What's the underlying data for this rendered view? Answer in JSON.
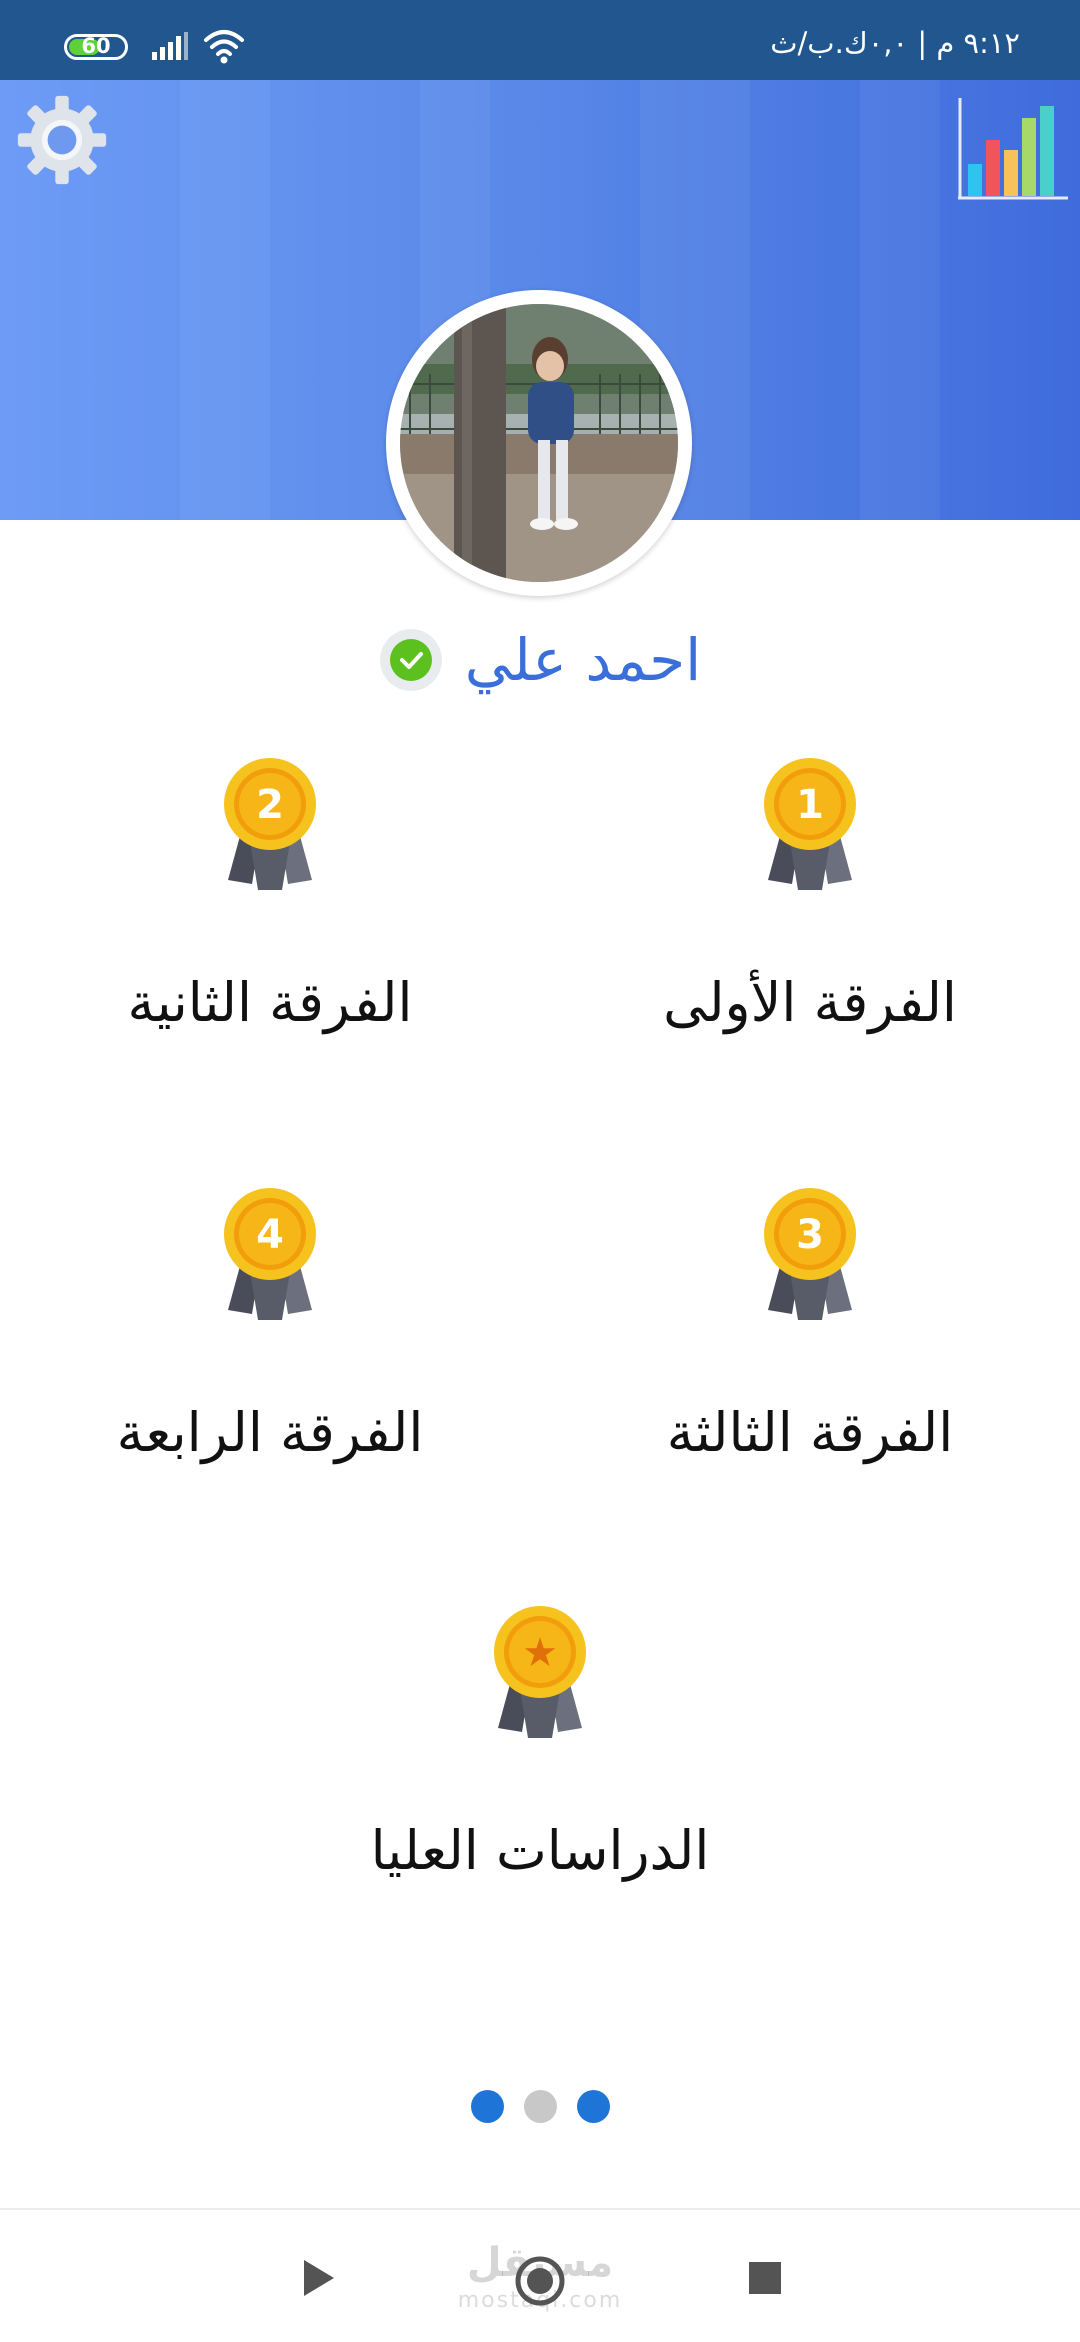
{
  "status_bar": {
    "battery_level": "60",
    "time": "٩:١٢ م | ٠,٠ك.ب/ث",
    "battery_color": "#5ed13a",
    "background": "#21568e"
  },
  "header": {
    "settings_icon": "gear-icon",
    "stats_icon": "bar-chart-icon"
  },
  "profile": {
    "name": "احمد علي",
    "verified_icon": "check-circle-icon",
    "name_color": "#3a6ed8"
  },
  "levels": [
    {
      "label": "الفرقة الأولى",
      "badge": "1",
      "icon": "medal-icon"
    },
    {
      "label": "الفرقة الثانية",
      "badge": "2",
      "icon": "medal-icon"
    },
    {
      "label": "الفرقة الثالثة",
      "badge": "3",
      "icon": "medal-icon"
    },
    {
      "label": "الفرقة الرابعة",
      "badge": "4",
      "icon": "medal-icon"
    },
    {
      "label": "الدراسات العليا",
      "badge": "★",
      "icon": "star-medal-icon"
    }
  ],
  "pager": {
    "dots": [
      "active",
      "inactive",
      "active"
    ],
    "active_color": "#1f74d8",
    "inactive_color": "#c8c8c8"
  },
  "watermark": {
    "text": "مستقل",
    "subtext": "mostaql.com"
  },
  "nav_bar": {
    "back_icon": "play-back-icon",
    "home_icon": "home-circle-icon",
    "recent_icon": "stop-square-icon"
  }
}
